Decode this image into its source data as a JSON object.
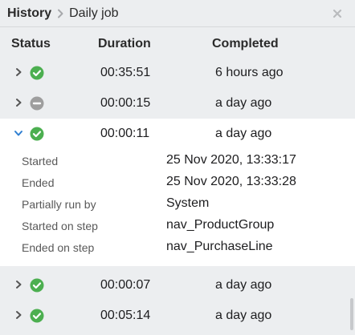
{
  "breadcrumb": {
    "root": "History",
    "current": "Daily job"
  },
  "columns": {
    "status": "Status",
    "duration": "Duration",
    "completed": "Completed"
  },
  "rows": [
    {
      "status": "success",
      "duration": "00:35:51",
      "completed": "6 hours ago",
      "expanded": false
    },
    {
      "status": "cancelled",
      "duration": "00:00:15",
      "completed": "a day ago",
      "expanded": false
    },
    {
      "status": "success",
      "duration": "00:00:11",
      "completed": "a day ago",
      "expanded": true
    },
    {
      "status": "success",
      "duration": "00:00:07",
      "completed": "a day ago",
      "expanded": false
    },
    {
      "status": "success",
      "duration": "00:05:14",
      "completed": "a day ago",
      "expanded": false
    }
  ],
  "details": [
    {
      "label": "Started",
      "value": "25 Nov 2020, 13:33:17"
    },
    {
      "label": "Ended",
      "value": "25 Nov 2020, 13:33:28"
    },
    {
      "label": "Partially run by",
      "value": "System"
    },
    {
      "label": "Started on step",
      "value": "nav_ProductGroup"
    },
    {
      "label": "Ended on step",
      "value": "nav_PurchaseLine"
    }
  ],
  "colors": {
    "success": "#4caf50",
    "cancelled": "#9e9e9e",
    "chevron": "#555555",
    "chevron_expanded": "#2f7fd1"
  },
  "icons": {
    "close": "close-icon",
    "breadcrumb_separator": "chevron-right-icon",
    "success": "check-circle-icon",
    "cancelled": "minus-circle-icon"
  }
}
